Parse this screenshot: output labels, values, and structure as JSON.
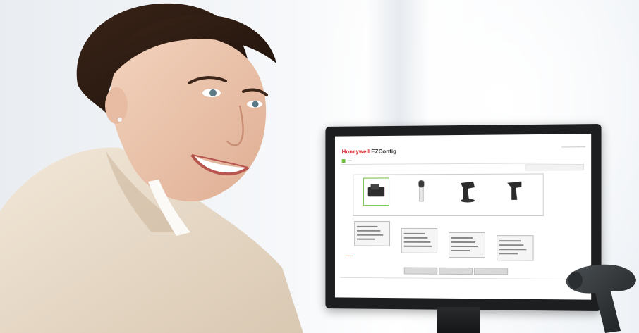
{
  "app": {
    "brand_primary": "Honeywell",
    "brand_secondary": "EZConfig"
  },
  "colors": {
    "brand_red": "#d21f26",
    "accent_green": "#6cbf3c"
  },
  "icons": [
    "scanner-device-icon",
    "barcode-scanner-icon"
  ]
}
